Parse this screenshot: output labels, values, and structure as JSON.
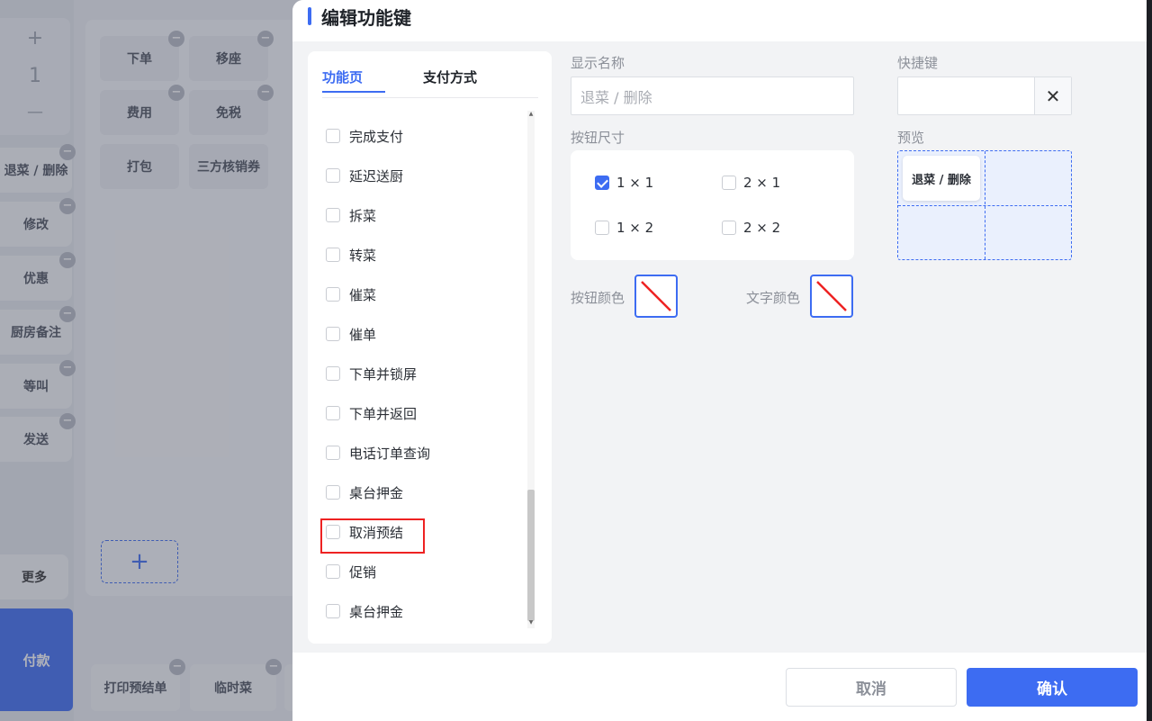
{
  "background": {
    "stepper": {
      "plus": "+",
      "value": "1",
      "minus": "—"
    },
    "side_buttons": [
      "退菜 / 删除",
      "修改",
      "优惠",
      "厨房备注",
      "等叫",
      "发送"
    ],
    "grid_buttons": [
      "下单",
      "移座",
      "费用",
      "免税",
      "打包",
      "三方核销券"
    ],
    "more_label": "更多",
    "pay_label": "付款",
    "add_label": "+",
    "bottom_buttons": [
      "打印预结单",
      "临时菜"
    ],
    "minus_glyph": "−"
  },
  "dialog": {
    "title": "编辑功能键",
    "tabs": [
      "功能页",
      "支付方式"
    ],
    "items": [
      "完成支付",
      "延迟送厨",
      "拆菜",
      "转菜",
      "催菜",
      "催单",
      "下单并锁屏",
      "下单并返回",
      "电话订单查询",
      "桌台押金",
      "取消预结",
      "促销",
      "桌台押金"
    ],
    "display_name_label": "显示名称",
    "display_name_value": "退菜 / 删除",
    "hotkey_label": "快捷键",
    "hotkey_clear": "✕",
    "size_label": "按钮尺寸",
    "sizes": [
      {
        "label": "1 × 1",
        "checked": true
      },
      {
        "label": "2 × 1",
        "checked": false
      },
      {
        "label": "1 × 2",
        "checked": false
      },
      {
        "label": "2 × 2",
        "checked": false
      }
    ],
    "preview_label": "预览",
    "preview_button": "退菜 / 删除",
    "button_color_label": "按钮颜色",
    "text_color_label": "文字颜色",
    "cancel": "取消",
    "confirm": "确认"
  },
  "colors": {
    "accent": "#3d6cf2",
    "highlight": "#e22222"
  }
}
